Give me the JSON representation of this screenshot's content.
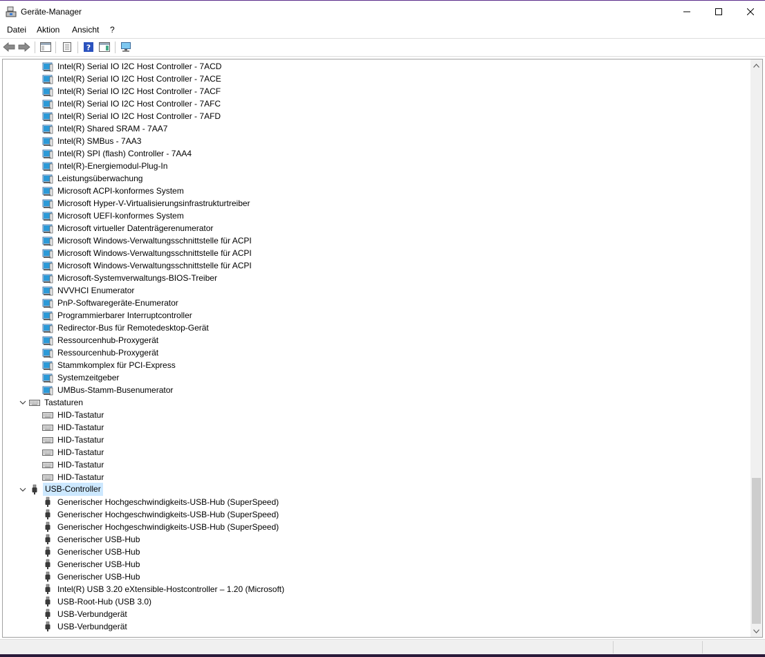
{
  "window": {
    "title": "Geräte-Manager",
    "accent_color": "#5a2a8a"
  },
  "menu": {
    "items": [
      {
        "label": "Datei"
      },
      {
        "label": "Aktion"
      },
      {
        "label": "Ansicht"
      },
      {
        "label": "?"
      }
    ]
  },
  "toolbar": {
    "buttons": [
      {
        "icon": "back-arrow-icon"
      },
      {
        "icon": "forward-arrow-icon"
      },
      {
        "icon": "show-hide-console-tree-icon"
      },
      {
        "icon": "properties-icon"
      },
      {
        "icon": "help-icon"
      },
      {
        "icon": "action-pane-icon"
      },
      {
        "icon": "scan-hardware-monitor-icon"
      }
    ]
  },
  "tree": {
    "selection_color": "#cce8ff",
    "rows": [
      {
        "label": "Intel(R) Serial IO I2C Host Controller - 7ACD",
        "icon": "system-device-icon",
        "level": 2
      },
      {
        "label": "Intel(R) Serial IO I2C Host Controller - 7ACE",
        "icon": "system-device-icon",
        "level": 2
      },
      {
        "label": "Intel(R) Serial IO I2C Host Controller - 7ACF",
        "icon": "system-device-icon",
        "level": 2
      },
      {
        "label": "Intel(R) Serial IO I2C Host Controller - 7AFC",
        "icon": "system-device-icon",
        "level": 2
      },
      {
        "label": "Intel(R) Serial IO I2C Host Controller - 7AFD",
        "icon": "system-device-icon",
        "level": 2
      },
      {
        "label": "Intel(R) Shared SRAM - 7AA7",
        "icon": "system-device-icon",
        "level": 2
      },
      {
        "label": "Intel(R) SMBus - 7AA3",
        "icon": "system-device-icon",
        "level": 2
      },
      {
        "label": "Intel(R) SPI (flash) Controller - 7AA4",
        "icon": "system-device-icon",
        "level": 2
      },
      {
        "label": "Intel(R)-Energiemodul-Plug-In",
        "icon": "system-device-icon",
        "level": 2
      },
      {
        "label": "Leistungsüberwachung",
        "icon": "system-device-icon",
        "level": 2
      },
      {
        "label": "Microsoft ACPI-konformes System",
        "icon": "system-device-icon",
        "level": 2
      },
      {
        "label": "Microsoft Hyper-V-Virtualisierungsinfrastrukturtreiber",
        "icon": "system-device-icon",
        "level": 2
      },
      {
        "label": "Microsoft UEFI-konformes System",
        "icon": "system-device-icon",
        "level": 2
      },
      {
        "label": "Microsoft virtueller Datenträgerenumerator",
        "icon": "system-device-icon",
        "level": 2
      },
      {
        "label": "Microsoft Windows-Verwaltungsschnittstelle für ACPI",
        "icon": "system-device-icon",
        "level": 2
      },
      {
        "label": "Microsoft Windows-Verwaltungsschnittstelle für ACPI",
        "icon": "system-device-icon",
        "level": 2
      },
      {
        "label": "Microsoft Windows-Verwaltungsschnittstelle für ACPI",
        "icon": "system-device-icon",
        "level": 2
      },
      {
        "label": "Microsoft-Systemverwaltungs-BIOS-Treiber",
        "icon": "system-device-icon",
        "level": 2
      },
      {
        "label": "NVVHCI Enumerator",
        "icon": "system-device-icon",
        "level": 2
      },
      {
        "label": "PnP-Softwaregeräte-Enumerator",
        "icon": "system-device-icon",
        "level": 2
      },
      {
        "label": "Programmierbarer Interruptcontroller",
        "icon": "system-device-icon",
        "level": 2
      },
      {
        "label": "Redirector-Bus für Remotedesktop-Gerät",
        "icon": "system-device-icon",
        "level": 2
      },
      {
        "label": "Ressourcenhub-Proxygerät",
        "icon": "system-device-icon",
        "level": 2
      },
      {
        "label": "Ressourcenhub-Proxygerät",
        "icon": "system-device-icon",
        "level": 2
      },
      {
        "label": "Stammkomplex für PCI-Express",
        "icon": "system-device-icon",
        "level": 2
      },
      {
        "label": "Systemzeitgeber",
        "icon": "system-device-icon",
        "level": 2
      },
      {
        "label": "UMBus-Stamm-Busenumerator",
        "icon": "system-device-icon",
        "level": 2
      },
      {
        "label": "Tastaturen",
        "icon": "keyboard-icon",
        "level": 1,
        "expanded": true
      },
      {
        "label": "HID-Tastatur",
        "icon": "keyboard-icon",
        "level": 2
      },
      {
        "label": "HID-Tastatur",
        "icon": "keyboard-icon",
        "level": 2
      },
      {
        "label": "HID-Tastatur",
        "icon": "keyboard-icon",
        "level": 2
      },
      {
        "label": "HID-Tastatur",
        "icon": "keyboard-icon",
        "level": 2
      },
      {
        "label": "HID-Tastatur",
        "icon": "keyboard-icon",
        "level": 2
      },
      {
        "label": "HID-Tastatur",
        "icon": "keyboard-icon",
        "level": 2
      },
      {
        "label": "USB-Controller",
        "icon": "usb-plug-icon",
        "level": 1,
        "expanded": true,
        "selected": true
      },
      {
        "label": "Generischer Hochgeschwindigkeits-USB-Hub (SuperSpeed)",
        "icon": "usb-plug-icon",
        "level": 2
      },
      {
        "label": "Generischer Hochgeschwindigkeits-USB-Hub (SuperSpeed)",
        "icon": "usb-plug-icon",
        "level": 2
      },
      {
        "label": "Generischer Hochgeschwindigkeits-USB-Hub (SuperSpeed)",
        "icon": "usb-plug-icon",
        "level": 2
      },
      {
        "label": "Generischer USB-Hub",
        "icon": "usb-plug-icon",
        "level": 2
      },
      {
        "label": "Generischer USB-Hub",
        "icon": "usb-plug-icon",
        "level": 2
      },
      {
        "label": "Generischer USB-Hub",
        "icon": "usb-plug-icon",
        "level": 2
      },
      {
        "label": "Generischer USB-Hub",
        "icon": "usb-plug-icon",
        "level": 2
      },
      {
        "label": "Intel(R) USB 3.20 eXtensible-Hostcontroller – 1.20 (Microsoft)",
        "icon": "usb-plug-icon",
        "level": 2
      },
      {
        "label": "USB-Root-Hub (USB 3.0)",
        "icon": "usb-plug-icon",
        "level": 2
      },
      {
        "label": "USB-Verbundgerät",
        "icon": "usb-plug-icon",
        "level": 2
      },
      {
        "label": "USB-Verbundgerät",
        "icon": "usb-plug-icon",
        "level": 2
      }
    ]
  },
  "statusbar": {
    "panels": [
      "",
      "",
      ""
    ]
  }
}
